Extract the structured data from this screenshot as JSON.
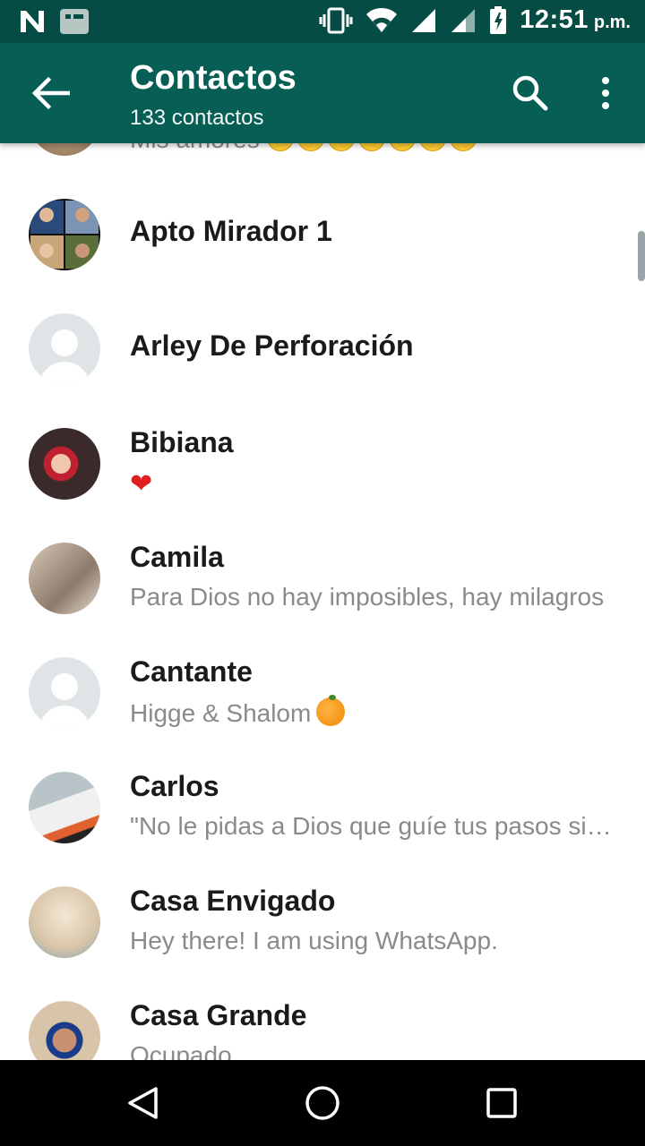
{
  "status_bar": {
    "time": "12:51",
    "ampm": "p.m.",
    "icons": [
      "n-logo-icon",
      "gallery-icon",
      "vibrate-icon",
      "wifi-icon",
      "signal-icon",
      "signal-icon-2",
      "battery-charging-icon"
    ]
  },
  "app_bar": {
    "title": "Contactos",
    "subtitle": "133 contactos",
    "color": "#075e54",
    "status_color": "#054d44"
  },
  "contacts": [
    {
      "name": "",
      "status": "Mis amores",
      "avatar": "photo"
    },
    {
      "name": "Apto Mirador 1",
      "status": "",
      "avatar": "photo-collage"
    },
    {
      "name": "Arley De Perforación",
      "status": "",
      "avatar": "default"
    },
    {
      "name": "Bibiana",
      "status": "❤",
      "avatar": "photo"
    },
    {
      "name": "Camila",
      "status": "Para Dios no hay imposibles, hay milagros",
      "avatar": "photo"
    },
    {
      "name": "Cantante",
      "status": "Higge & Shalom",
      "avatar": "default"
    },
    {
      "name": "Carlos",
      "status": "\"No le pidas a Dios que guíe tus pasos si no estás dispuesto a mover los pies\"",
      "avatar": "photo"
    },
    {
      "name": "Casa Envigado",
      "status": "Hey there! I am using WhatsApp.",
      "avatar": "photo"
    },
    {
      "name": "Casa Grande",
      "status": "Ocupado",
      "avatar": "photo"
    }
  ],
  "nav_bar": {
    "buttons": [
      "back-triangle-icon",
      "home-circle-icon",
      "recents-square-icon"
    ]
  }
}
